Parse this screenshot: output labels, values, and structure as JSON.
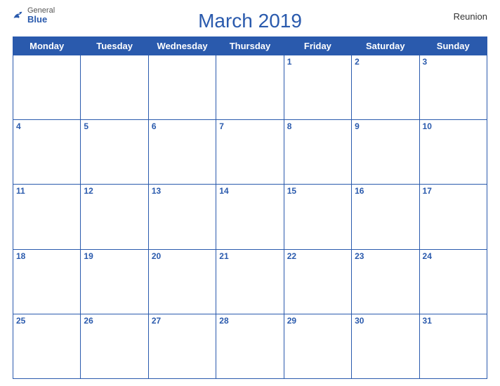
{
  "header": {
    "title": "March 2019",
    "region": "Reunion",
    "logo": {
      "general": "General",
      "blue": "Blue"
    }
  },
  "weekdays": [
    "Monday",
    "Tuesday",
    "Wednesday",
    "Thursday",
    "Friday",
    "Saturday",
    "Sunday"
  ],
  "weeks": [
    [
      null,
      null,
      null,
      null,
      1,
      2,
      3
    ],
    [
      4,
      5,
      6,
      7,
      8,
      9,
      10
    ],
    [
      11,
      12,
      13,
      14,
      15,
      16,
      17
    ],
    [
      18,
      19,
      20,
      21,
      22,
      23,
      24
    ],
    [
      25,
      26,
      27,
      28,
      29,
      30,
      31
    ]
  ],
  "colors": {
    "blue": "#2a5aad",
    "row_bg": "#dce8f8"
  }
}
